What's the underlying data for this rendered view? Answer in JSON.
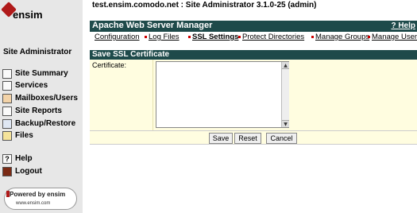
{
  "window": {
    "title": "test.ensim.comodo.net : Site Administrator 3.1.0-25 (admin)"
  },
  "brand": {
    "logo_text": "ensim"
  },
  "sidebar": {
    "title": "Site Administrator",
    "items": [
      {
        "label": "Site Summary",
        "icon": "site-summary-icon"
      },
      {
        "label": "Services",
        "icon": "services-icon"
      },
      {
        "label": "Mailboxes/Users",
        "icon": "users-icon"
      },
      {
        "label": "Site Reports",
        "icon": "reports-icon"
      },
      {
        "label": "Backup/Restore",
        "icon": "backup-icon"
      },
      {
        "label": "Files",
        "icon": "folder-icon"
      }
    ],
    "help_label": "Help",
    "logout_label": "Logout",
    "powered_by": "Powered by ensim",
    "powered_url": "www.ensim.com"
  },
  "module": {
    "title": "Apache Web Server Manager",
    "help_label": "Help",
    "help_icon_text": "?",
    "nav": [
      {
        "label": "Configuration"
      },
      {
        "label": "Log Files"
      },
      {
        "label": "SSL Settings"
      },
      {
        "label": "Protect Directories"
      },
      {
        "label": "Manage Groups"
      },
      {
        "label": "Manage Users"
      }
    ]
  },
  "section": {
    "title": "Save SSL Certificate",
    "certificate_label": "Certificate:",
    "certificate_value": ""
  },
  "buttons": {
    "save": "Save",
    "reset": "Reset",
    "cancel": "Cancel"
  },
  "colors": {
    "header_bg": "#1e4a4a",
    "sidebar_bg": "#e7e7e7",
    "form_bg": "#fffde0",
    "brand_red": "#b01a1a"
  }
}
